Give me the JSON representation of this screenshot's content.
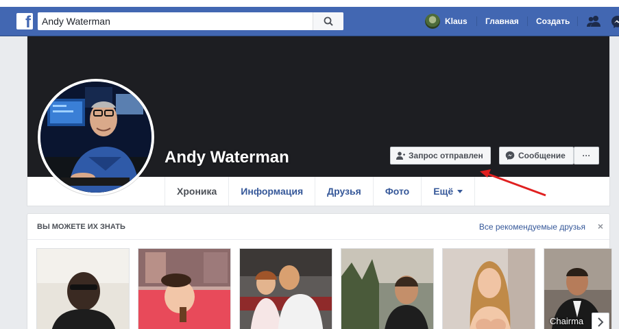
{
  "header": {
    "search_value": "Andy Waterman",
    "user_name": "Klaus",
    "home_label": "Главная",
    "create_label": "Создать"
  },
  "profile": {
    "name": "Andy Waterman",
    "request_button": "Запрос отправлен",
    "message_button": "Сообщение",
    "more_button": "···"
  },
  "tabs": [
    {
      "label": "Хроника"
    },
    {
      "label": "Информация"
    },
    {
      "label": "Друзья"
    },
    {
      "label": "Фото"
    },
    {
      "label": "Ещё"
    }
  ],
  "pymk": {
    "title": "Вы можете их знать",
    "see_all": "Все рекомендуемые друзья",
    "close": "×",
    "cards": [
      {
        "label": ""
      },
      {
        "label": ""
      },
      {
        "label": ""
      },
      {
        "label": ""
      },
      {
        "label": ""
      },
      {
        "label": "Chairma"
      }
    ]
  },
  "colors": {
    "brand_blue": "#4267b2",
    "link_blue": "#365899",
    "arrow_red": "#e02020"
  }
}
